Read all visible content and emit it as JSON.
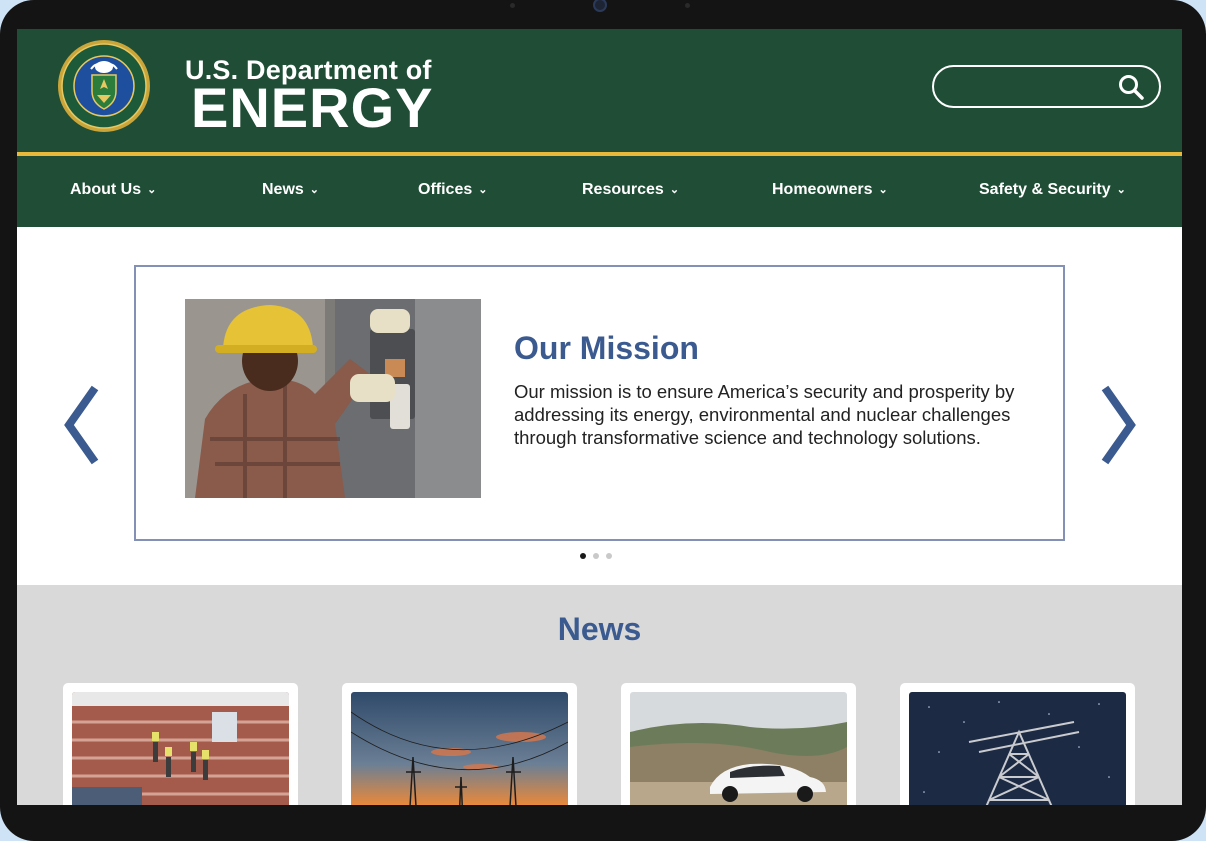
{
  "header": {
    "brand_small": "U.S. Department of",
    "brand_big": "ENERGY",
    "seal_icon": "doe-seal-icon",
    "search": {
      "placeholder": "",
      "icon": "search-icon"
    }
  },
  "nav": {
    "items": [
      {
        "label": "About Us"
      },
      {
        "label": "News"
      },
      {
        "label": "Offices"
      },
      {
        "label": "Resources"
      },
      {
        "label": "Homeowners"
      },
      {
        "label": "Safety & Security"
      }
    ],
    "chevron_icon": "chevron-down-icon"
  },
  "hero": {
    "title": "Our Mission",
    "text": "Our mission is to ensure America’s security and prosperity by addressing its energy, environmental and nuclear challenges through transformative science and technology solutions.",
    "prev_icon": "chevron-left-icon",
    "next_icon": "chevron-right-icon",
    "slide_count": 3,
    "active_slide": 1
  },
  "news": {
    "title": "News",
    "cards": [
      {
        "image": "rooftop-solar-workers-photo"
      },
      {
        "image": "power-lines-sunset-photo"
      },
      {
        "image": "electric-car-photo"
      },
      {
        "image": "transmission-tower-night-photo"
      }
    ]
  },
  "colors": {
    "header_green": "#1f4d35",
    "gold_stripe": "#e8b93a",
    "accent_blue": "#3b5a8f",
    "news_bg": "#d9d9d9"
  }
}
